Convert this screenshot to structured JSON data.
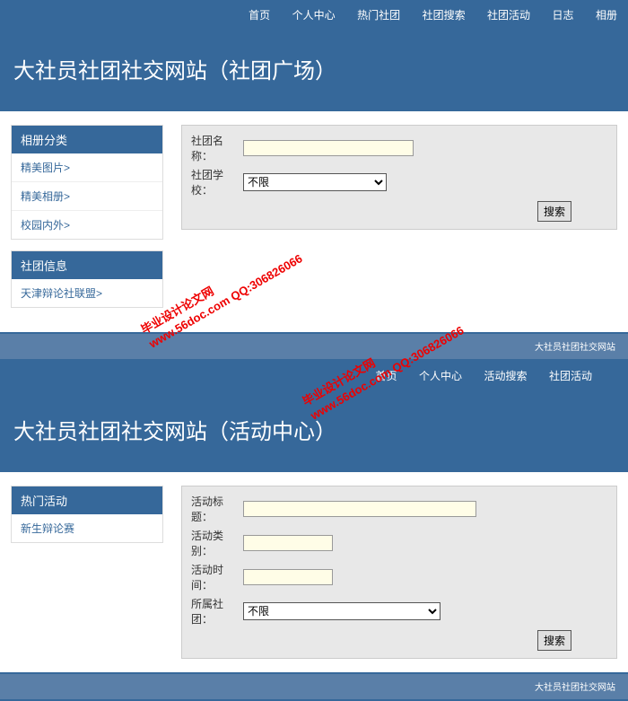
{
  "section1": {
    "nav": [
      {
        "label": "首页"
      },
      {
        "label": "个人中心"
      },
      {
        "label": "热门社团"
      },
      {
        "label": "社团搜索"
      },
      {
        "label": "社团活动"
      },
      {
        "label": "日志"
      },
      {
        "label": "相册"
      }
    ],
    "banner_title": "大社员社团社交网站（社团广场）",
    "sidebar": [
      {
        "title": "相册分类",
        "items": [
          "精美图片>",
          "精美相册>",
          "校园内外>"
        ]
      },
      {
        "title": "社团信息",
        "items": [
          "天津辩论社联盟>"
        ]
      }
    ],
    "form": {
      "row1_label": "社团名称：",
      "row2_label": "社团学校：",
      "select_value": "不限",
      "search_btn": "搜索"
    },
    "footer": "大社员社团社交网站"
  },
  "section2": {
    "nav": [
      {
        "label": "首页"
      },
      {
        "label": "个人中心"
      },
      {
        "label": "活动搜索"
      },
      {
        "label": "社团活动"
      }
    ],
    "banner_title": "大社员社团社交网站（活动中心）",
    "sidebar": [
      {
        "title": "热门活动",
        "items": [
          "新生辩论赛"
        ]
      }
    ],
    "form": {
      "row1_label": "活动标题：",
      "row2_label": "活动类别：",
      "row3_label": "活动时间：",
      "row4_label": "所属社团：",
      "select_value": "不限",
      "search_btn": "搜索"
    },
    "footer": "大社员社团社交网站"
  },
  "watermark": {
    "line1": "毕业设计论文网",
    "line2": "www.56doc.com  QQ:306826066"
  }
}
